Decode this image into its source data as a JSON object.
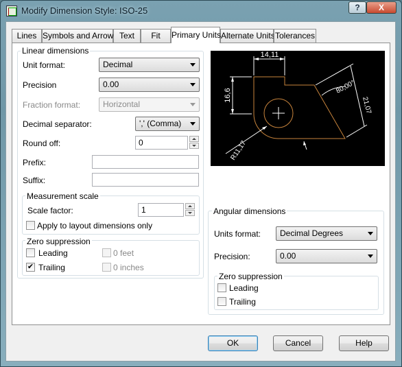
{
  "window": {
    "title": "Modify Dimension Style: ISO-25",
    "help_glyph": "?",
    "close_glyph": "X"
  },
  "tabs": [
    "Lines",
    "Symbols and Arrows",
    "Text",
    "Fit",
    "Primary Units",
    "Alternate Units",
    "Tolerances"
  ],
  "active_tab": "Primary Units",
  "linear": {
    "title": "Linear dimensions",
    "unit_format_label": "Unit format:",
    "unit_format_value": "Decimal",
    "precision_label": "Precision",
    "precision_value": "0.00",
    "fraction_label": "Fraction format:",
    "fraction_value": "Horizontal",
    "decimal_sep_label": "Decimal separator:",
    "decimal_sep_value": "',' (Comma)",
    "round_off_label": "Round off:",
    "round_off_value": "0",
    "prefix_label": "Prefix:",
    "prefix_value": "",
    "suffix_label": "Suffix:",
    "suffix_value": ""
  },
  "measurement": {
    "title": "Measurement scale",
    "scale_label": "Scale factor:",
    "scale_value": "1",
    "apply_layout_label": "Apply to layout dimensions only",
    "apply_layout_checked": false
  },
  "zero_linear": {
    "title": "Zero suppression",
    "leading_label": "Leading",
    "leading_checked": false,
    "trailing_label": "Trailing",
    "trailing_checked": true,
    "feet_label": "0 feet",
    "inches_label": "0 inches"
  },
  "preview": {
    "dim_top": "14,11",
    "dim_left": "16,6",
    "dim_right": "80,00°",
    "dim_diag": "21,07",
    "dim_radius": "R11,17"
  },
  "angular": {
    "title": "Angular dimensions",
    "units_label": "Units format:",
    "units_value": "Decimal Degrees",
    "precision_label": "Precision:",
    "precision_value": "0.00"
  },
  "zero_angular": {
    "title": "Zero suppression",
    "leading_label": "Leading",
    "leading_checked": false,
    "trailing_label": "Trailing",
    "trailing_checked": false
  },
  "buttons": {
    "ok": "OK",
    "cancel": "Cancel",
    "help": "Help"
  },
  "colors": {
    "preview_bg": "#000000",
    "preview_lines": "#ffffff",
    "preview_object": "#c8843c"
  }
}
